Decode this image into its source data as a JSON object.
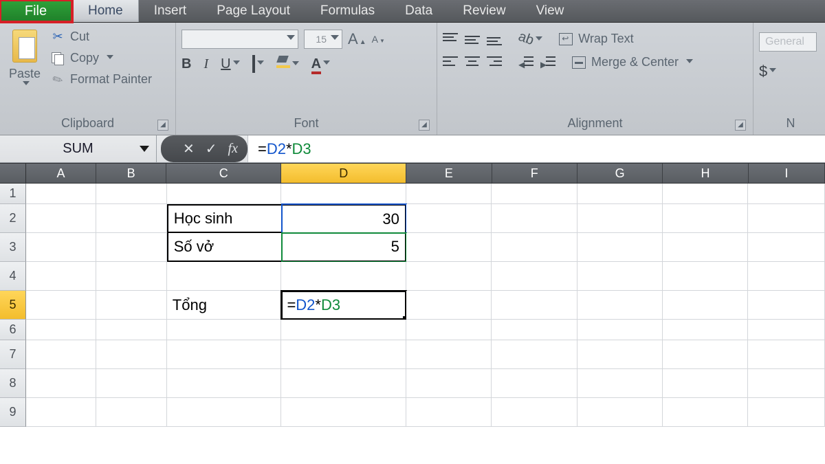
{
  "tabs": {
    "file": "File",
    "home": "Home",
    "insert": "Insert",
    "page_layout": "Page Layout",
    "formulas": "Formulas",
    "data": "Data",
    "review": "Review",
    "view": "View"
  },
  "ribbon": {
    "clipboard": {
      "group": "Clipboard",
      "paste": "Paste",
      "cut": "Cut",
      "copy": "Copy",
      "format_painter": "Format Painter"
    },
    "font": {
      "group": "Font",
      "size_value": "15",
      "bold": "B",
      "italic": "I",
      "underline": "U",
      "font_color_letter": "A",
      "grow_big": "A",
      "grow_small": "A"
    },
    "alignment": {
      "group": "Alignment",
      "wrap_text": "Wrap Text",
      "merge_center": "Merge & Center"
    },
    "number": {
      "group_initial": "N",
      "format_hint": "General",
      "currency": "$"
    }
  },
  "formula_bar": {
    "name_box": "SUM",
    "cancel": "✕",
    "enter": "✓",
    "fx": "fx",
    "formula_eq": "= ",
    "formula_ref1": "D2",
    "formula_op": " * ",
    "formula_ref2": "D3"
  },
  "columns": [
    "A",
    "B",
    "C",
    "D",
    "E",
    "F",
    "G",
    "H",
    "I"
  ],
  "rows": [
    "1",
    "2",
    "3",
    "4",
    "5",
    "6",
    "7",
    "8",
    "9"
  ],
  "cells": {
    "C2": "Học  sinh",
    "D2": "30",
    "C3": "Số vở",
    "D3": "5",
    "C5": "Tổng",
    "D5_eq": "= ",
    "D5_r1": "D2",
    "D5_op": " * ",
    "D5_r2": "D3"
  },
  "active": {
    "column": "D",
    "row": "5"
  }
}
